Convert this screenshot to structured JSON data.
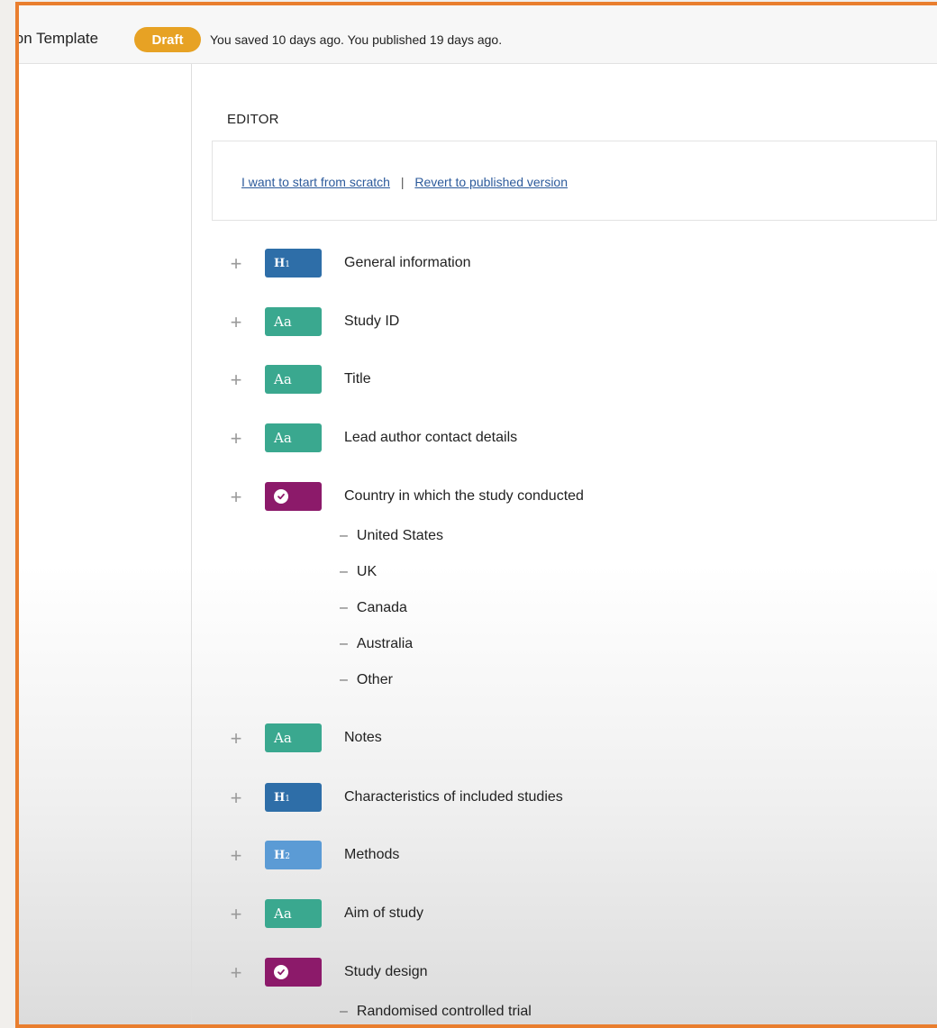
{
  "header": {
    "template_title": "ion Template",
    "status_badge": "Draft",
    "save_status": "You saved 10 days ago.  You published 19 days ago."
  },
  "editor": {
    "label": "EDITOR",
    "start_scratch_link": "I want to start from scratch",
    "separator": "|",
    "revert_link": "Revert to published version"
  },
  "fields": [
    {
      "type": "heading1",
      "chip": "H1",
      "label": "General information"
    },
    {
      "type": "text",
      "chip": "Aa",
      "label": "Study ID"
    },
    {
      "type": "text",
      "chip": "Aa",
      "label": "Title"
    },
    {
      "type": "text",
      "chip": "Aa",
      "label": "Lead author contact details"
    },
    {
      "type": "choice",
      "chip": "check-icon",
      "label": "Country in which the study conducted",
      "options": [
        "United States",
        "UK",
        "Canada",
        "Australia",
        "Other"
      ]
    },
    {
      "type": "text",
      "chip": "Aa",
      "label": "Notes"
    },
    {
      "type": "heading1",
      "chip": "H1",
      "label": "Characteristics of included studies"
    },
    {
      "type": "heading2",
      "chip": "H2",
      "label": "Methods"
    },
    {
      "type": "text",
      "chip": "Aa",
      "label": "Aim of study"
    },
    {
      "type": "choice",
      "chip": "check-icon",
      "label": "Study design",
      "options": [
        "Randomised controlled trial"
      ]
    }
  ],
  "option_dash": "–",
  "plus_symbol": "+",
  "colors": {
    "frame_border": "#e97e2e",
    "draft_badge": "#e7a224",
    "heading1_chip": "#2e6ea8",
    "heading2_chip": "#5b9bd5",
    "text_chip": "#3aa88f",
    "choice_chip": "#8c1a6a",
    "link": "#2c5a9b"
  }
}
